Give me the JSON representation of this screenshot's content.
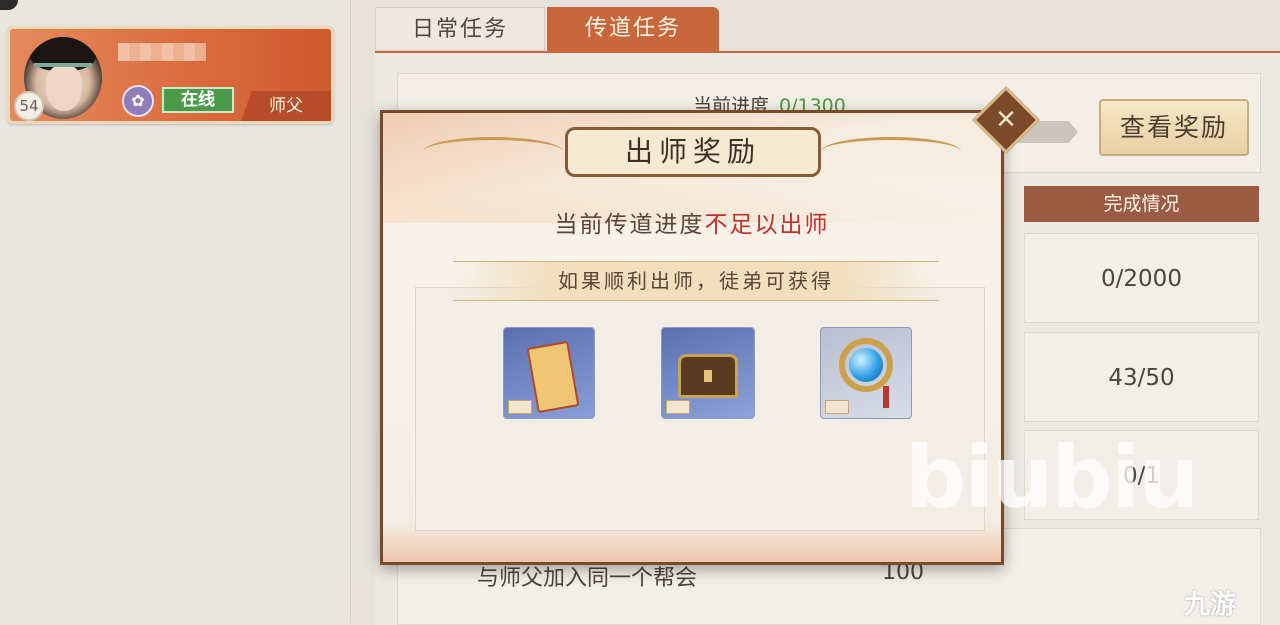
{
  "player": {
    "level": "54",
    "status": "在线",
    "role": "师父"
  },
  "tabs": {
    "daily": "日常任务",
    "mentor": "传道任务"
  },
  "progress": {
    "label": "当前进度",
    "value": "0/1300"
  },
  "view_reward_button": "查看奖励",
  "table": {
    "header": "完成情况",
    "rows": [
      "0/2000",
      "43/50",
      "0/1"
    ]
  },
  "bottom_task": {
    "label": "与师父加入同一个帮会",
    "reward": "100"
  },
  "modal": {
    "title": "出师奖励",
    "message_normal": "当前传道进度",
    "message_warn": "不足以出师",
    "subtitle": "如果顺利出师，徒弟可获得",
    "close_symbol": "✕",
    "items": [
      {
        "icon": "scroll-icon"
      },
      {
        "icon": "treasure-chest-icon"
      },
      {
        "icon": "jade-pendant-icon"
      }
    ]
  },
  "watermarks": {
    "biubiu": "biubiu",
    "site": "九游"
  },
  "colors": {
    "accent": "#c9673c",
    "online": "#4a9a4a",
    "warn": "#c0312a",
    "progress_value": "#4a9a3a"
  }
}
